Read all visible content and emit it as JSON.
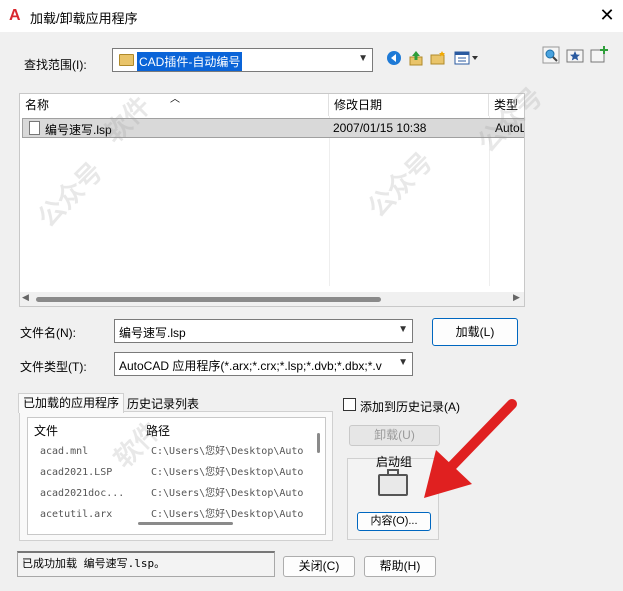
{
  "window": {
    "title": "加载/卸载应用程序",
    "close_glyph": "✕",
    "app_icon_glyph": "A"
  },
  "look_in": {
    "label": "查找范围(I):",
    "value": "CAD插件-自动编号"
  },
  "toolbar": {
    "icons": [
      "back-icon",
      "up-folder-icon",
      "new-folder-icon",
      "views-icon",
      "search-web-icon",
      "favorites-icon",
      "add-favorite-icon"
    ]
  },
  "file_list": {
    "columns": [
      "名称",
      "修改日期",
      "类型"
    ],
    "rows": [
      {
        "name": "编号速写.lsp",
        "date": "2007/01/15 10:38",
        "type": "AutoL"
      }
    ]
  },
  "file_name": {
    "label": "文件名(N):",
    "value": "编号速写.lsp"
  },
  "file_type": {
    "label": "文件类型(T):",
    "value": "AutoCAD 应用程序(*.arx;*.crx;*.lsp;*.dvb;*.dbx;*.v"
  },
  "load_button": "加载(L)",
  "tabs": {
    "loaded": "已加载的应用程序",
    "history": "历史记录列表"
  },
  "loaded_list": {
    "columns": [
      "文件",
      "路径"
    ],
    "rows": [
      {
        "file": "acad.mnl",
        "path": "C:\\Users\\您好\\Desktop\\Auto"
      },
      {
        "file": "acad2021.LSP",
        "path": "C:\\Users\\您好\\Desktop\\Auto"
      },
      {
        "file": "acad2021doc...",
        "path": "C:\\Users\\您好\\Desktop\\Auto"
      },
      {
        "file": "acetutil.arx",
        "path": "C:\\Users\\您好\\Desktop\\Auto"
      }
    ]
  },
  "add_history_label": "添加到历史记录(A)",
  "unload_button": "卸载(U)",
  "startup_group": {
    "label": "启动组",
    "contents_button": "内容(O)..."
  },
  "status_text": "已成功加载 编号速写.lsp。",
  "close_button": "关闭(C)",
  "help_button": "帮助(H)",
  "colors": {
    "selection": "#0a64d8",
    "arrow": "#e02020"
  },
  "watermarks": [
    "公众号",
    "软件",
    "公众号",
    "软件",
    "公众号"
  ]
}
